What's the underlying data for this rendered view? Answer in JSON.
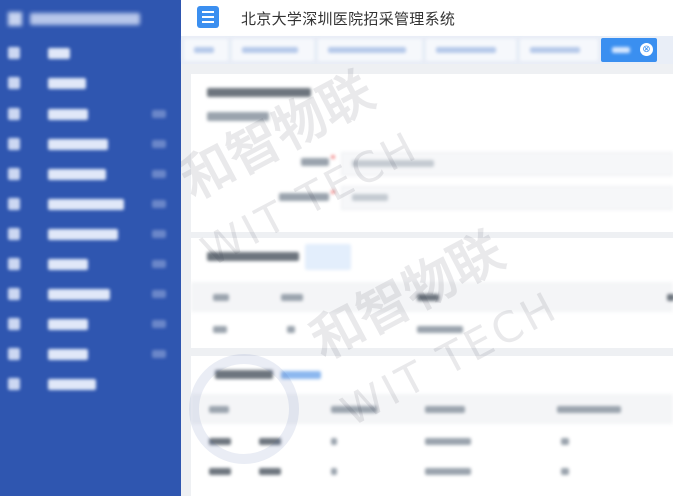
{
  "header": {
    "title": "北京大学深圳医院招采管理系统",
    "tab_close_glyph": "⊗"
  },
  "sidebar": {
    "item_count": 13
  },
  "watermark": {
    "brand_cn": "和智物联",
    "brand_en": "WIT TECH"
  },
  "colors": {
    "sidebar_bg": "#2f56b0",
    "accent": "#3a8ff0",
    "content_bg": "#eef0f3"
  },
  "icons": [
    "menu-icon",
    "close-icon"
  ]
}
